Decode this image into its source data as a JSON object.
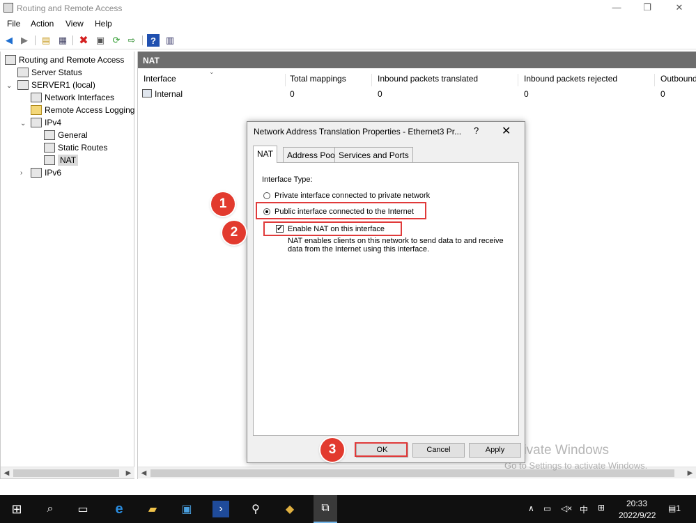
{
  "window": {
    "title": "Routing and Remote Access",
    "minimize": "—",
    "restore": "❐",
    "close": "✕"
  },
  "menu": [
    "File",
    "Action",
    "View",
    "Help"
  ],
  "toolbar": {
    "icons": [
      "back-icon",
      "forward-icon",
      "up-folder-icon",
      "show-hide-tree-icon",
      "delete-icon",
      "properties-icon",
      "refresh-icon",
      "export-icon",
      "help-icon",
      "view-icon"
    ]
  },
  "tree": {
    "root": "Routing and Remote Access",
    "server_status": "Server Status",
    "server": "SERVER1 (local)",
    "network_interfaces": "Network Interfaces",
    "remote_access_logging": "Remote Access Logging",
    "ipv4": "IPv4",
    "general": "General",
    "static_routes": "Static Routes",
    "nat": "NAT",
    "ipv6": "IPv6"
  },
  "pane": {
    "header": "NAT",
    "columns": [
      "Interface",
      "Total mappings",
      "Inbound packets translated",
      "Inbound packets rejected",
      "Outbound"
    ],
    "rows": [
      {
        "interface": "Internal",
        "total_mappings": "0",
        "inbound_translated": "0",
        "inbound_rejected": "0",
        "outbound": "0"
      }
    ]
  },
  "dialog": {
    "title": "Network Address Translation Properties - Ethernet3 Pr...",
    "help": "?",
    "close": "✕",
    "tabs": [
      "NAT",
      "Address Pool",
      "Services and Ports"
    ],
    "active_tab": "NAT",
    "interface_type_label": "Interface Type:",
    "option_private": "Private interface connected to private network",
    "option_public": "Public interface connected to the Internet",
    "selected_option": "public",
    "enable_nat_label": "Enable NAT on this interface",
    "enable_nat_checked": true,
    "check_mark": "✔",
    "nat_description_line1": "NAT enables clients on this network to send data to and receive",
    "nat_description_line2": "data from the Internet using this interface.",
    "ok": "OK",
    "cancel": "Cancel",
    "apply": "Apply"
  },
  "annotations": {
    "step1": "1",
    "step2": "2",
    "step3": "3",
    "color": "#e23a2e"
  },
  "watermark": {
    "line1": "Activate Windows",
    "line2": "Go to Settings to activate Windows."
  },
  "taskbar": {
    "time": "20:33",
    "date": "2022/9/22",
    "ime": "中",
    "notification_count": "1"
  },
  "colors": {
    "pane_header": "#6d6d6d",
    "taskbar": "#101010",
    "annotation_red": "#e23a2e"
  }
}
